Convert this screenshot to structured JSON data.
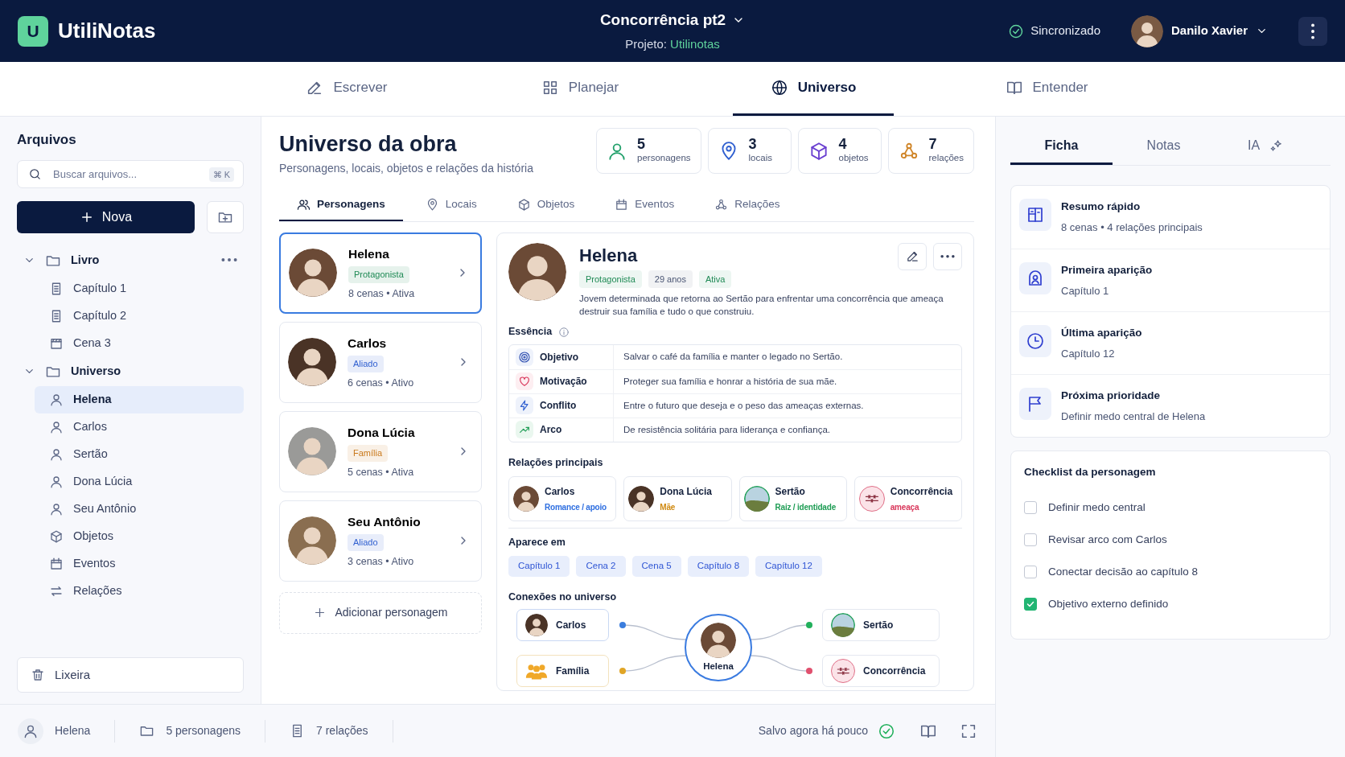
{
  "app": {
    "logo": "U",
    "name": "UtiliNotas"
  },
  "document": {
    "title": "Concorrência pt2",
    "project_label": "Projeto:",
    "project_name": "Utilinotas"
  },
  "sync_status": "Sincronizado",
  "user": {
    "name": "Danilo Xavier"
  },
  "main_tabs": [
    {
      "label": "Escrever",
      "selected": false
    },
    {
      "label": "Planejar",
      "selected": false
    },
    {
      "label": "Universo",
      "selected": true
    },
    {
      "label": "Entender",
      "selected": false
    }
  ],
  "sidebar": {
    "title": "Arquivos",
    "search": {
      "placeholder": "Buscar arquivos...",
      "shortcut": "⌘ K"
    },
    "new_button": "Nova",
    "tree": [
      {
        "label": "Livro",
        "kind": "folder",
        "expanded": true,
        "selected": false,
        "menu": true,
        "children": [
          {
            "label": "Capítulo 1",
            "kind": "chapter",
            "selected": false
          },
          {
            "label": "Capítulo 2",
            "kind": "chapter",
            "selected": false
          },
          {
            "label": "Cena 3",
            "kind": "scene",
            "selected": false
          }
        ]
      },
      {
        "label": "Universo",
        "kind": "folder",
        "expanded": true,
        "selected": false,
        "menu": false,
        "children": [
          {
            "label": "Helena",
            "kind": "character",
            "selected": true
          },
          {
            "label": "Carlos",
            "kind": "character",
            "selected": false
          },
          {
            "label": "Sertão",
            "kind": "character",
            "selected": false
          },
          {
            "label": "Dona Lúcia",
            "kind": "character",
            "selected": false
          },
          {
            "label": "Seu Antônio",
            "kind": "character",
            "selected": false
          },
          {
            "label": "Objetos",
            "kind": "objects",
            "selected": false
          },
          {
            "label": "Eventos",
            "kind": "events",
            "selected": false
          },
          {
            "label": "Relações",
            "kind": "relations",
            "selected": false
          }
        ]
      }
    ],
    "trash": "Lixeira"
  },
  "universe": {
    "title": "Universo da obra",
    "subtitle": "Personagens, locais, objetos e relações da história",
    "stats": [
      {
        "value": "5",
        "label": "personagens"
      },
      {
        "value": "3",
        "label": "locais"
      },
      {
        "value": "4",
        "label": "objetos"
      },
      {
        "value": "7",
        "label": "relações"
      }
    ],
    "tabs": [
      {
        "label": "Personagens",
        "selected": true
      },
      {
        "label": "Locais",
        "selected": false
      },
      {
        "label": "Objetos",
        "selected": false
      },
      {
        "label": "Eventos",
        "selected": false
      },
      {
        "label": "Relações",
        "selected": false
      }
    ],
    "characters": [
      {
        "name": "Helena",
        "role": "Protagonista",
        "color": "#1f8a55",
        "meta": "8 cenas • Ativa",
        "selected": true
      },
      {
        "name": "Carlos",
        "role": "Aliado",
        "color": "#2f5fd0",
        "meta": "6 cenas • Ativo",
        "selected": false
      },
      {
        "name": "Dona Lúcia",
        "role": "Família",
        "color": "#c9791c",
        "meta": "5 cenas • Ativa",
        "selected": false
      },
      {
        "name": "Seu Antônio",
        "role": "Aliado",
        "color": "#2f5fd0",
        "meta": "3 cenas • Ativo",
        "selected": false
      }
    ],
    "add_button": "Adicionar personagem",
    "detail": {
      "name": "Helena",
      "tags": [
        {
          "text": "Protagonista",
          "color": "#1f8a55"
        },
        {
          "text": "29 anos",
          "color": "#4a5573"
        },
        {
          "text": "Ativa",
          "color": "#1f8a55"
        }
      ],
      "description": "Jovem determinada que retorna ao Sertão para enfrentar uma concorrência que ameaça destruir sua família e tudo o que construiu.",
      "essence_title": "Essência",
      "essence": [
        {
          "label": "Objetivo",
          "text": "Salvar o café da família e manter o legado no Sertão."
        },
        {
          "label": "Motivação",
          "text": "Proteger sua família e honrar a história de sua mãe."
        },
        {
          "label": "Conflito",
          "text": "Entre o futuro que deseja e o peso das ameaças externas."
        },
        {
          "label": "Arco",
          "text": "De resistência solitária para liderança e confiança."
        }
      ],
      "relations_title": "Relações principais",
      "relations": [
        {
          "name": "Carlos",
          "kind": "person",
          "role": "Romance / apoio",
          "color": "#2f6fe0"
        },
        {
          "name": "Dona Lúcia",
          "kind": "person",
          "role": "Mãe",
          "color": "#d08a12"
        },
        {
          "name": "Sertão",
          "kind": "place",
          "role": "Raiz / identidade",
          "color": "#1f9d55"
        },
        {
          "name": "Concorrência",
          "kind": "threat",
          "role": "ameaça",
          "color": "#d9365a"
        }
      ],
      "appears_title": "Aparece em",
      "appears_in": [
        "Capítulo 1",
        "Cena 2",
        "Cena 5",
        "Capítulo 8",
        "Capítulo 12"
      ],
      "connections_title": "Conexões no universo",
      "connections": {
        "center": "Helena",
        "left": [
          {
            "label": "Carlos",
            "kind": "person",
            "color": "#3b7ddd"
          },
          {
            "label": "Família",
            "kind": "group",
            "color": "#e0a526"
          }
        ],
        "right": [
          {
            "label": "Sertão",
            "kind": "place",
            "color": "#22b05c"
          },
          {
            "label": "Concorrência",
            "kind": "threat",
            "color": "#e0506e"
          }
        ]
      }
    }
  },
  "inspector": {
    "tabs": [
      {
        "label": "Ficha",
        "selected": true
      },
      {
        "label": "Notas",
        "selected": false
      },
      {
        "label": "IA",
        "selected": false
      }
    ],
    "summary": [
      {
        "title": "Resumo rápido",
        "text": "8 cenas • 4 relações principais"
      },
      {
        "title": "Primeira aparição",
        "text": "Capítulo 1"
      },
      {
        "title": "Última aparição",
        "text": "Capítulo 12"
      },
      {
        "title": "Próxima prioridade",
        "text": "Definir medo central de Helena"
      }
    ],
    "checklist_title": "Checklist da personagem",
    "checklist": [
      {
        "label": "Definir medo central",
        "checked": false
      },
      {
        "label": "Revisar arco com Carlos",
        "checked": false
      },
      {
        "label": "Conectar decisão ao capítulo 8",
        "checked": false
      },
      {
        "label": "Objetivo externo definido",
        "checked": true
      }
    ]
  },
  "status_bar": {
    "items": [
      "Helena",
      "5 personagens",
      "7 relações"
    ],
    "saved": "Salvo agora há pouco"
  }
}
